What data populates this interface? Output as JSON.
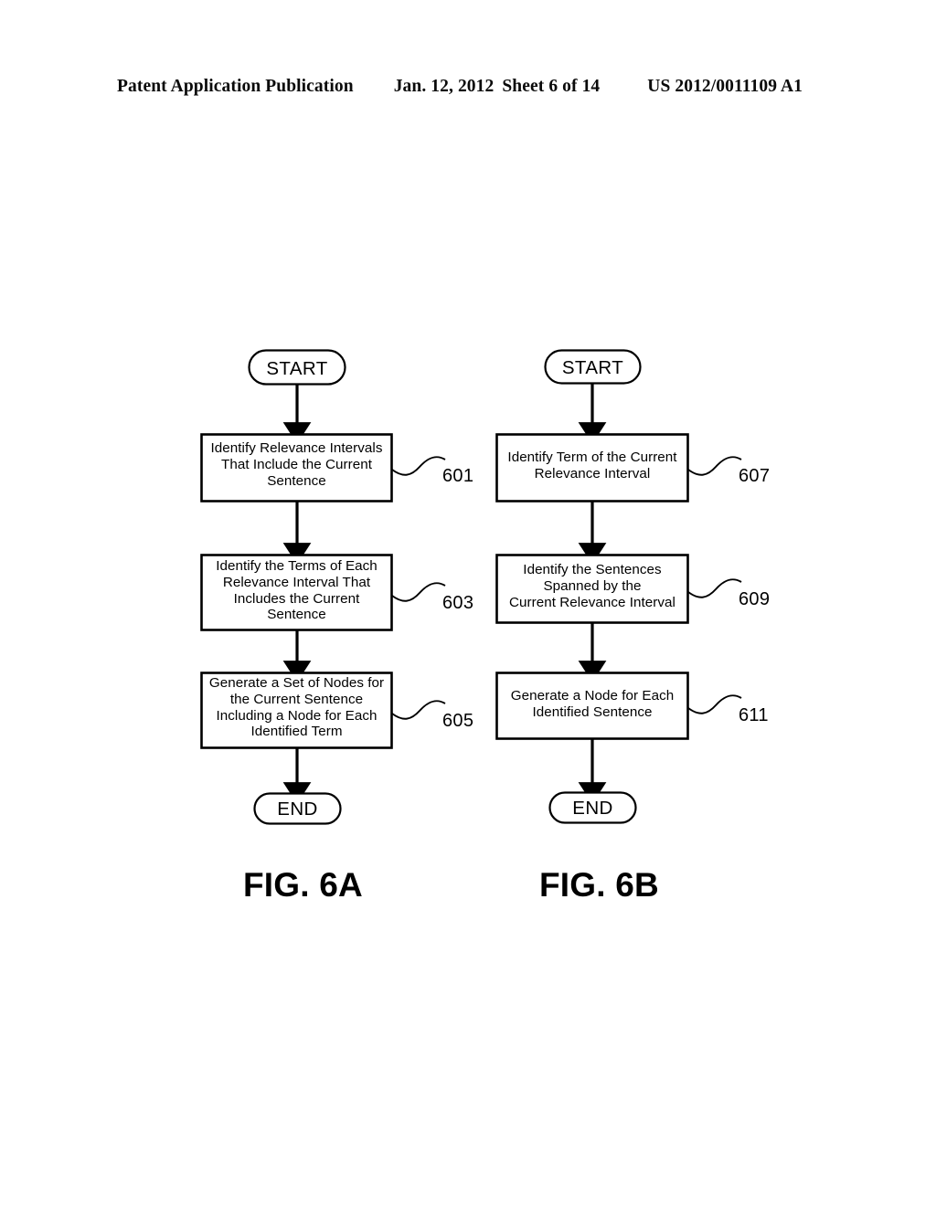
{
  "header": {
    "publication": "Patent Application Publication",
    "date": "Jan. 12, 2012",
    "sheet": "Sheet 6 of 14",
    "patent_number": "US 2012/0011109 A1"
  },
  "figures": [
    {
      "caption": "FIG. 6A",
      "nodes": [
        {
          "id": "start-a",
          "type": "terminator",
          "label": "START"
        },
        {
          "id": "step-601",
          "type": "process",
          "label": "Identify Relevance Intervals\nThat Include the Current\nSentence",
          "ref": "601"
        },
        {
          "id": "step-603",
          "type": "process",
          "label": "Identify the Terms of Each\nRelevance Interval That\nIncludes the Current\nSentence",
          "ref": "603"
        },
        {
          "id": "step-605",
          "type": "process",
          "label": "Generate a Set of Nodes for\nthe Current Sentence\nIncluding a Node for Each\nIdentified Term",
          "ref": "605"
        },
        {
          "id": "end-a",
          "type": "terminator",
          "label": "END"
        }
      ]
    },
    {
      "caption": "FIG. 6B",
      "nodes": [
        {
          "id": "start-b",
          "type": "terminator",
          "label": "START"
        },
        {
          "id": "step-607",
          "type": "process",
          "label": "Identify Term of the Current\nRelevance Interval",
          "ref": "607"
        },
        {
          "id": "step-609",
          "type": "process",
          "label": "Identify the Sentences\nSpanned  by the\nCurrent Relevance Interval",
          "ref": "609"
        },
        {
          "id": "step-611",
          "type": "process",
          "label": "Generate a Node for Each\nIdentified Sentence",
          "ref": "611"
        },
        {
          "id": "end-b",
          "type": "terminator",
          "label": "END"
        }
      ]
    }
  ],
  "colors": {
    "ink": "#000000",
    "paper": "#ffffff"
  }
}
